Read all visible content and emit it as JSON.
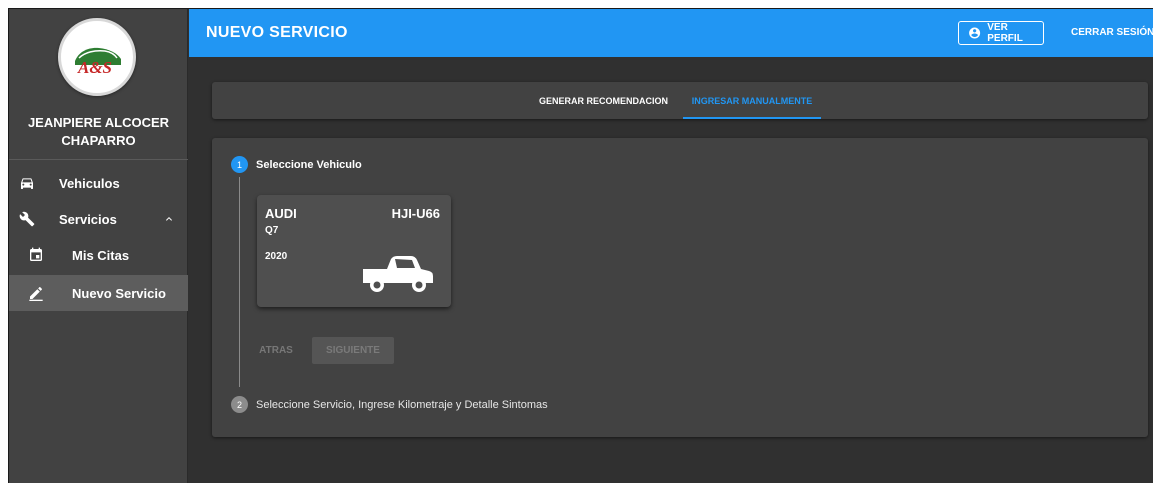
{
  "user": {
    "name_line1": "JEANPIERE ALCOCER",
    "name_line2": "CHAPARRO"
  },
  "logo": {
    "text": "A&S"
  },
  "sidebar": {
    "items": [
      {
        "label": "Vehiculos",
        "icon": "car-icon"
      },
      {
        "label": "Servicios",
        "icon": "wrench-icon",
        "expanded": true
      },
      {
        "label": "Mis Citas",
        "icon": "calendar-icon"
      },
      {
        "label": "Nuevo Servicio",
        "icon": "edit-icon",
        "active": true
      }
    ]
  },
  "header": {
    "title": "NUEVO SERVICIO",
    "profile_button": "VER PERFIL",
    "logout_button": "CERRAR SESIÓN"
  },
  "tabs": [
    {
      "label": "GENERAR RECOMENDACION",
      "active": false
    },
    {
      "label": "INGRESAR MANUALMENTE",
      "active": true
    }
  ],
  "stepper": {
    "step1": {
      "number": "1",
      "label": "Seleccione Vehiculo"
    },
    "step2": {
      "number": "2",
      "label": "Seleccione Servicio, Ingrese Kilometraje y Detalle Sintomas"
    },
    "back_button": "ATRAS",
    "next_button": "SIGUIENTE"
  },
  "vehicle": {
    "brand": "AUDI",
    "plate": "HJI-U66",
    "model": "Q7",
    "year": "2020",
    "icon": "pickup-truck-icon"
  },
  "colors": {
    "accent": "#2196f3",
    "sidebar": "#424242",
    "background": "#303030",
    "active_item": "#5d5d5d"
  }
}
